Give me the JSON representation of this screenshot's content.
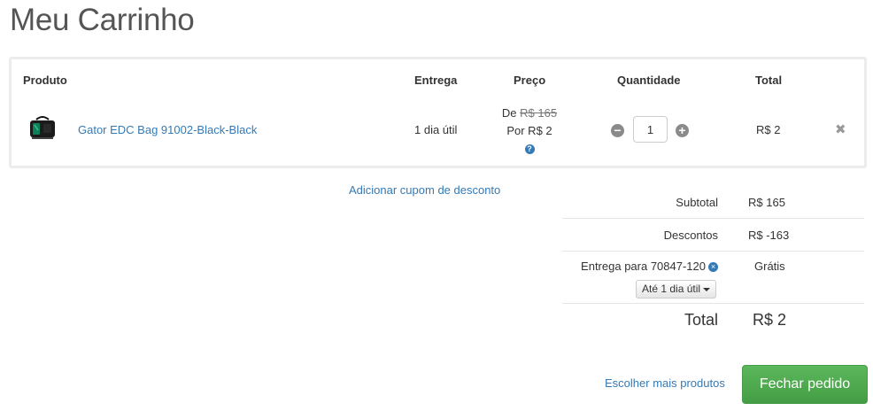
{
  "page": {
    "title": "Meu Carrinho"
  },
  "cart": {
    "headers": {
      "produto": "Produto",
      "entrega": "Entrega",
      "preco": "Preço",
      "quantidade": "Quantidade",
      "total": "Total"
    },
    "item": {
      "name": "Gator EDC Bag 91002-Black-Black",
      "delivery": "1 dia útil",
      "price_from_prefix": "De",
      "price_from": "R$ 165",
      "price_to": "Por R$ 2",
      "help_icon": "question-circle-icon",
      "quantity": "1",
      "line_total": "R$ 2",
      "remove_icon": "times-icon"
    }
  },
  "coupon": {
    "link_label": "Adicionar cupom de desconto"
  },
  "summary": {
    "subtotal_label": "Subtotal",
    "subtotal_value": "R$ 165",
    "discount_label": "Descontos",
    "discount_value": "R$ -163",
    "shipping_label": "Entrega para 70847-120",
    "shipping_value": "Grátis",
    "shipping_option": "Até 1 dia útil",
    "total_label": "Total",
    "total_value": "R$ 2"
  },
  "actions": {
    "more_products": "Escolher mais produtos",
    "checkout": "Fechar pedido"
  },
  "colors": {
    "link": "#337ab7",
    "checkout_button": "#5cb85c",
    "title": "#555555"
  }
}
